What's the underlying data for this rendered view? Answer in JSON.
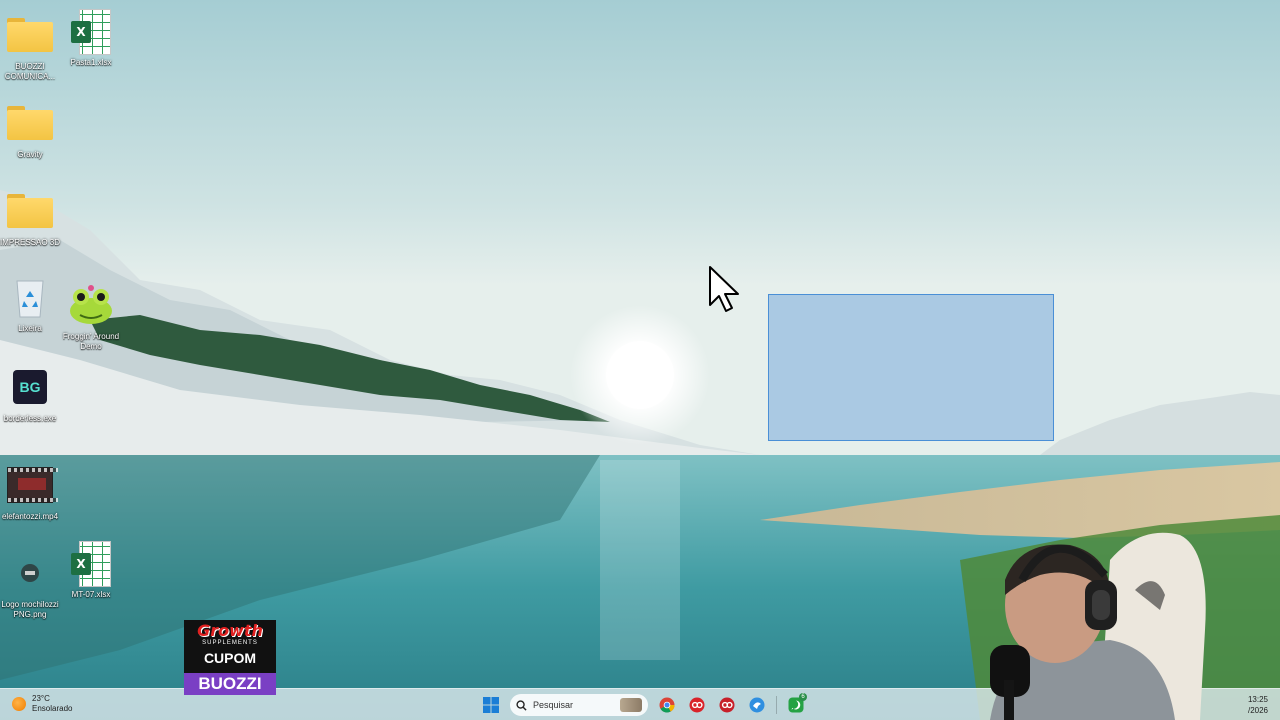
{
  "desktop": {
    "icons": [
      {
        "label": "BUOZZI COMUNICA...",
        "icon": "folder-icon"
      },
      {
        "label": "Pasta1.xlsx",
        "icon": "excel-file-icon"
      },
      {
        "label": "Gravity",
        "icon": "folder-icon"
      },
      {
        "label": "IMPRESSAO 3D",
        "icon": "folder-icon"
      },
      {
        "label": "Lixeira",
        "icon": "recycle-bin-icon"
      },
      {
        "label": "Froggin' Around Demo",
        "icon": "frog-game-icon"
      },
      {
        "label": "borderless.exe",
        "icon": "bg-app-icon",
        "glyph": "BG"
      },
      {
        "label": "elefantozzi.mp4",
        "icon": "video-file-icon"
      },
      {
        "label": "Logo mochilozzi PNG.png",
        "icon": "image-file-icon"
      },
      {
        "label": "MT-07.xlsx",
        "icon": "excel-file-icon"
      }
    ]
  },
  "overlay": {
    "brand": "Growth",
    "brand_sub": "SUPPLEMENTS",
    "cupom": "CUPOM",
    "code": "BUOZZI"
  },
  "taskbar": {
    "weather": {
      "temp": "23°C",
      "condition": "Ensolarado"
    },
    "search": {
      "placeholder": "Pesquisar"
    },
    "apps": [
      "chrome-icon",
      "app-red-icon",
      "app-red-icon-2",
      "app-blue-icon",
      "whatsapp-icon"
    ],
    "whatsapp_badge": "6",
    "clock": {
      "time": "13:25",
      "date": "/2026"
    }
  },
  "colors": {
    "selection_fill": "#78aadc",
    "selection_border": "#4a8fd6",
    "excel_green": "#1d6f42",
    "folder_yellow": "#f3c443",
    "growth_purple": "#7a3fc4",
    "growth_red": "#e02020"
  }
}
